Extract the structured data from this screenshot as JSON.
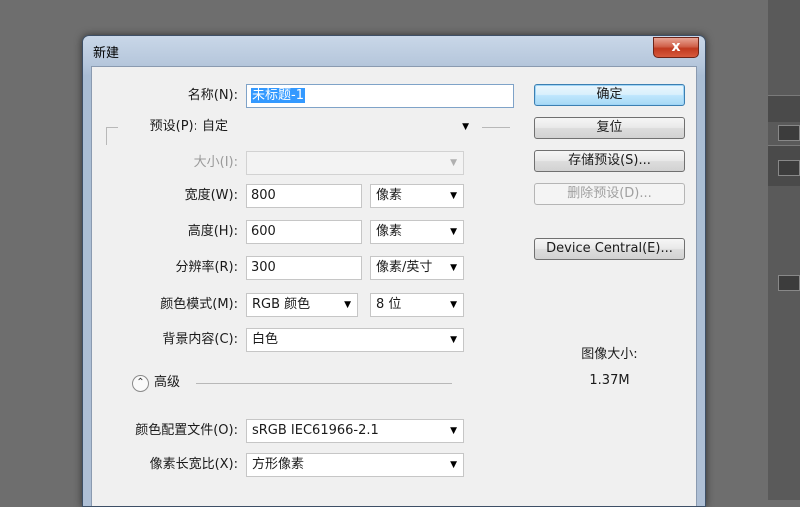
{
  "dialog": {
    "title": "新建",
    "close_label": "x",
    "fields": {
      "name": {
        "label": "名称(N):",
        "value": "未标题-1"
      },
      "preset": {
        "label": "预设(P):",
        "value": "自定"
      },
      "size": {
        "label": "大小(I):",
        "value": ""
      },
      "width": {
        "label": "宽度(W):",
        "value": "800",
        "unit": "像素"
      },
      "height": {
        "label": "高度(H):",
        "value": "600",
        "unit": "像素"
      },
      "resolution": {
        "label": "分辨率(R):",
        "value": "300",
        "unit": "像素/英寸"
      },
      "color_mode": {
        "label": "颜色模式(M):",
        "value": "RGB 颜色",
        "depth": "8 位"
      },
      "background": {
        "label": "背景内容(C):",
        "value": "白色"
      },
      "advanced": {
        "label": "高级"
      },
      "color_profile": {
        "label": "颜色配置文件(O):",
        "value": "sRGB IEC61966-2.1"
      },
      "pixel_aspect": {
        "label": "像素长宽比(X):",
        "value": "方形像素"
      }
    },
    "buttons": {
      "ok": "确定",
      "reset": "复位",
      "save_preset": "存储预设(S)...",
      "delete_preset": "删除预设(D)...",
      "device_central": "Device Central(E)..."
    },
    "image_size": {
      "label": "图像大小:",
      "value": "1.37M"
    }
  },
  "icons": {
    "dropdown": "chevron-down-icon",
    "advanced": "collapse-up-icon"
  }
}
